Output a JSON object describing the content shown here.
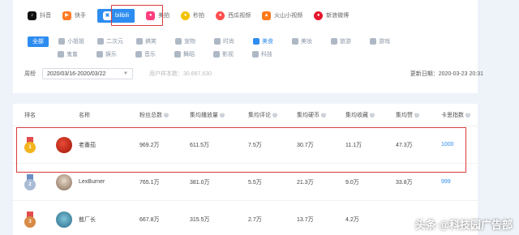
{
  "platforms": [
    {
      "label": "抖音",
      "icon": "douyin-icon",
      "color": "#111111",
      "glyph": "♪"
    },
    {
      "label": "快手",
      "icon": "kuaishou-icon",
      "color": "#ff7b24",
      "glyph": "●"
    },
    {
      "label": "bilibili",
      "icon": "bilibili-icon",
      "color": "#2d8cf0",
      "glyph": "▣",
      "active": true
    },
    {
      "label": "美拍",
      "icon": "meipai-icon",
      "color": "#ff3d7f",
      "glyph": "●"
    },
    {
      "label": "秒拍",
      "icon": "miaopai-icon",
      "color": "#f2c200",
      "glyph": "●"
    },
    {
      "label": "西瓜视频",
      "icon": "xigua-icon",
      "color": "#ff4e4e",
      "glyph": "●"
    },
    {
      "label": "火山小视频",
      "icon": "huoshan-icon",
      "color": "#ff7a1a",
      "glyph": "●"
    },
    {
      "label": "新浪微博",
      "icon": "weibo-icon",
      "color": "#e6162d",
      "glyph": "●"
    }
  ],
  "categories_row1": [
    "全部",
    "小姐姐",
    "二次元",
    "搞笑",
    "宠物",
    "时尚",
    "美食",
    "美妆",
    "旅游",
    "游戏"
  ],
  "categories_row2": [
    "鬼畜",
    "娱乐",
    "音乐",
    "舞蹈",
    "影视",
    "科技"
  ],
  "selected_category": "美食",
  "filter": {
    "label": "周榜",
    "date_range": "2020/03/16-2020/03/22",
    "user_count": "用户样本数：30,667,630",
    "updated": "更新日期：2020-03-23 20:31"
  },
  "table": {
    "headers": {
      "rank": "排名",
      "name": "名称",
      "fans": "粉丝总数",
      "play": "集均播放量",
      "comment": "集均评论",
      "coin": "集均硬币",
      "fav": "集均收藏",
      "like": "集均赞",
      "score": "卡思指数"
    },
    "rows": [
      {
        "rank": "1",
        "medal": "gold",
        "name": "老番茄",
        "fans": "969.2万",
        "play": "611.5万",
        "comment": "7.5万",
        "coin": "30.7万",
        "fav": "11.1万",
        "like": "47.3万",
        "score": "1000"
      },
      {
        "rank": "2",
        "medal": "silver",
        "name": "LexBurner",
        "fans": "765.1万",
        "play": "381.0万",
        "comment": "5.5万",
        "coin": "21.3万",
        "fav": "9.0万",
        "like": "33.8万",
        "score": "999"
      },
      {
        "rank": "3",
        "medal": "bronze",
        "name": "敖厂长",
        "fans": "667.8万",
        "play": "315.5万",
        "comment": "2.7万",
        "coin": "13.7万",
        "fav": "4.2万",
        "like": "",
        "score": ""
      }
    ]
  },
  "watermark": "头条 @科技园广告部"
}
